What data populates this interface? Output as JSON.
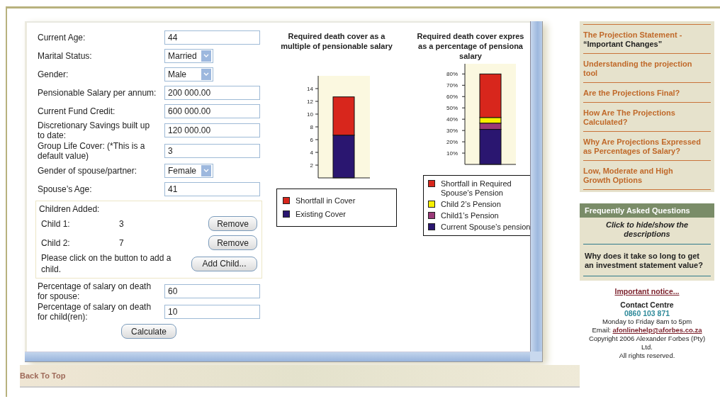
{
  "form": {
    "fields": [
      {
        "label": "Current Age:",
        "kind": "text",
        "value": "44"
      },
      {
        "label": "Marital Status:",
        "kind": "select",
        "value": "Married"
      },
      {
        "label": "Gender:",
        "kind": "select",
        "value": "Male"
      },
      {
        "label": "Pensionable Salary per annum:",
        "kind": "text",
        "value": "200 000.00"
      },
      {
        "label": "Current Fund Credit:",
        "kind": "text",
        "value": "600 000.00"
      },
      {
        "label": "Discretionary Savings built up to date:",
        "kind": "text",
        "value": "120 000.00"
      },
      {
        "label": "Group Life Cover: (*This is a default value)",
        "kind": "text",
        "value": "3"
      },
      {
        "label": "Gender of spouse/partner:",
        "kind": "select",
        "value": "Female"
      },
      {
        "label": "Spouse’s Age:",
        "kind": "text",
        "value": "41"
      }
    ],
    "children_panel": {
      "heading": "Children Added:",
      "children": [
        {
          "label": "Child 1:",
          "age": "3",
          "button": "Remove"
        },
        {
          "label": "Child 2:",
          "age": "7",
          "button": "Remove"
        }
      ],
      "hint": "Please click on the button to add a child.",
      "add_button": "Add Child..."
    },
    "extra_fields": [
      {
        "label": "Percentage of salary on death for spouse:",
        "kind": "text",
        "value": "60"
      },
      {
        "label": "Percentage of salary on death for child(ren):",
        "kind": "text",
        "value": "10"
      }
    ],
    "calculate_button": "Calculate"
  },
  "charts": [
    {
      "chart_data": {
        "type": "bar",
        "title": "Required death cover as a multiple of pensionable salary",
        "stacked": true,
        "ylim": [
          0,
          16
        ],
        "yticks": [
          2,
          4,
          6,
          8,
          10,
          12,
          14
        ],
        "series": [
          {
            "name": "Shortfall in Cover",
            "color": "#d8261c",
            "values": [
              6
            ]
          },
          {
            "name": "Existing Cover",
            "color": "#2a1670",
            "values": [
              6.7
            ]
          }
        ]
      }
    },
    {
      "chart_data": {
        "type": "bar",
        "title": "Required death cover expres as a percentage of pensiona salary",
        "stacked": true,
        "ylim": [
          0,
          89
        ],
        "yticks": [
          {
            "value": 10,
            "label": "10%"
          },
          {
            "value": 20,
            "label": "20%"
          },
          {
            "value": 30,
            "label": "30%"
          },
          {
            "value": 40,
            "label": "40%"
          },
          {
            "value": 50,
            "label": "50%"
          },
          {
            "value": 60,
            "label": "60%"
          },
          {
            "value": 70,
            "label": "70%"
          },
          {
            "value": 80,
            "label": "80%"
          }
        ],
        "series": [
          {
            "name": "Shortfall in Required Spouse’s Pension",
            "color": "#d8261c",
            "values": [
              38.5
            ]
          },
          {
            "name": "Child 2’s Pension",
            "color": "#f7f000",
            "values": [
              5
            ]
          },
          {
            "name": "Child1’s Pension",
            "color": "#9a3a78",
            "values": [
              5.5
            ]
          },
          {
            "name": "Current Spouse’s pension",
            "color": "#2a1670",
            "values": [
              31
            ]
          }
        ]
      }
    }
  ],
  "back_to_top": "Back To Top",
  "sidebar": {
    "links": [
      {
        "text": "The Projection Statement -",
        "subtext": "“Important Changes”"
      },
      {
        "text": "Understanding the projection tool"
      },
      {
        "text": "Are the Projections Final?"
      },
      {
        "text": "How Are The Projections Calculated?"
      },
      {
        "text": "Why Are Projections Expressed as Percentages of Salary?"
      },
      {
        "text": "Low, Moderate and High Growth Options"
      }
    ],
    "faq": {
      "title": "Frequently Asked Questions",
      "instruction": "Click to hide/show the descriptions",
      "questions": [
        "Why does it take so long to get an investment statement value?"
      ]
    },
    "footer": {
      "notice": "Important notice...",
      "contact_title": "Contact Centre",
      "phone": "0860 103 871",
      "hours": "Monday to Friday 8am to 5pm",
      "email_label": "Email:",
      "email": "afonlinehelp@aforbes.co.za",
      "copyright": "Copyright 2006 Alexander Forbes (Pty) Ltd.",
      "rights": "All rights reserved."
    }
  }
}
